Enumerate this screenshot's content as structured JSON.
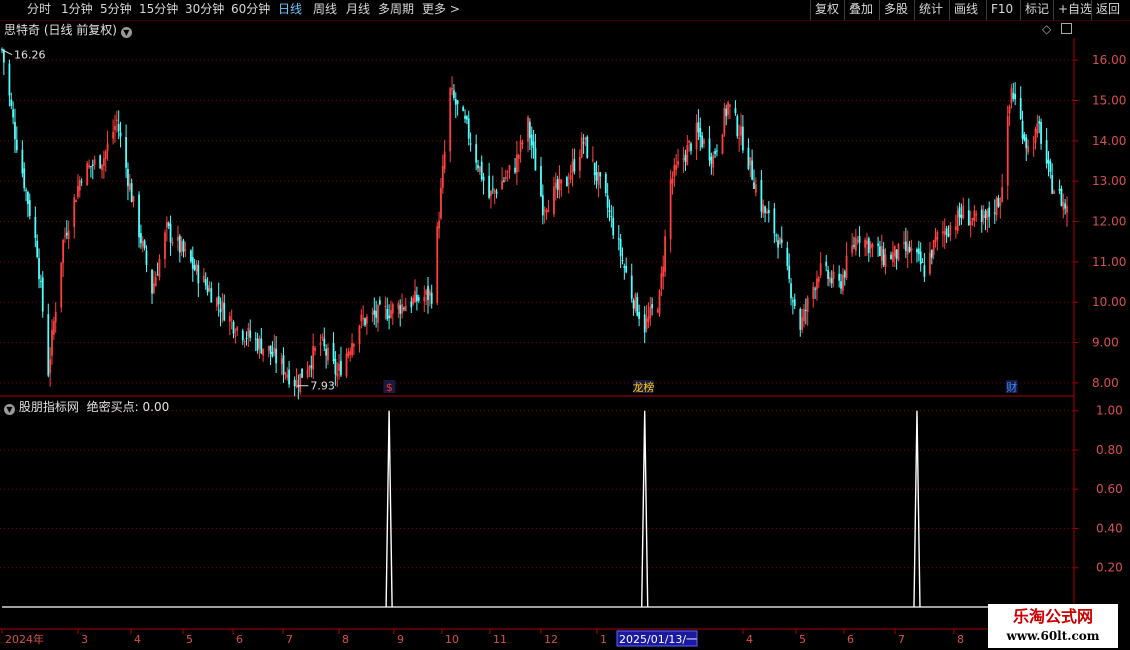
{
  "toolbar": {
    "periods": [
      "分时",
      "1分钟",
      "5分钟",
      "15分钟",
      "30分钟",
      "60分钟",
      "日线",
      "周线",
      "月线",
      "多周期",
      "更多 >"
    ],
    "active_period": "日线",
    "tools": [
      "复权",
      "叠加",
      "多股",
      "统计",
      "画线",
      "F10",
      "标记",
      "+自选",
      "返回"
    ]
  },
  "main_panel": {
    "title": "思特奇 (日线 前复权)",
    "high_marker": "16.26",
    "low_marker": "7.93",
    "event_markers": [
      {
        "label": "$",
        "color": "#ff3030",
        "date": "2024-08-26"
      },
      {
        "label": "龙虎榜",
        "display": "龙榜",
        "color": "#ffcc00",
        "date": "2025-01-08"
      },
      {
        "label": "财",
        "color": "#3a8cff",
        "date": "2025-07-28"
      }
    ]
  },
  "indicator_panel": {
    "title": "股朋指标网",
    "name": "绝密买点:",
    "value": "0.00"
  },
  "time_axis": {
    "labels": [
      "2024年",
      "3",
      "4",
      "5",
      "6",
      "7",
      "8",
      "9",
      "10",
      "11",
      "12",
      "1",
      "2025/01/13/一",
      "4",
      "5",
      "6",
      "7",
      "8"
    ],
    "highlight": "2025/01/13/一"
  },
  "watermark": {
    "line1": "乐淘公式网",
    "line2": "www.60lt.com"
  },
  "colors": {
    "up": "#ff4040",
    "down": "#50ffff",
    "axis": "#b00000",
    "grid": "#7a0000",
    "signal": "#ffffff"
  },
  "chart_data": [
    {
      "type": "candlestick",
      "title": "思特奇 (日线 前复权)",
      "ylim": [
        7.7,
        16.45
      ],
      "y_ticks": [
        8.0,
        9.0,
        10.0,
        11.0,
        12.0,
        13.0,
        14.0,
        15.0,
        16.0
      ],
      "grid": true,
      "x_range": [
        "2024-02-01",
        "2025-08-29"
      ],
      "anchors": [
        {
          "x": "2024-02-01",
          "y": 16.26
        },
        {
          "x": "2024-02-08",
          "y": 14.2
        },
        {
          "x": "2024-02-20",
          "y": 11.3
        },
        {
          "x": "2024-02-26",
          "y": 8.3
        },
        {
          "x": "2024-03-05",
          "y": 11.5
        },
        {
          "x": "2024-03-15",
          "y": 13.2
        },
        {
          "x": "2024-03-27",
          "y": 13.6
        },
        {
          "x": "2024-04-03",
          "y": 14.5
        },
        {
          "x": "2024-04-12",
          "y": 12.4
        },
        {
          "x": "2024-04-22",
          "y": 10.3
        },
        {
          "x": "2024-04-30",
          "y": 11.8
        },
        {
          "x": "2024-05-20",
          "y": 10.5
        },
        {
          "x": "2024-06-06",
          "y": 9.4
        },
        {
          "x": "2024-06-24",
          "y": 8.8
        },
        {
          "x": "2024-07-09",
          "y": 8.0
        },
        {
          "x": "2024-07-22",
          "y": 9.0
        },
        {
          "x": "2024-07-31",
          "y": 8.2
        },
        {
          "x": "2024-08-12",
          "y": 9.5
        },
        {
          "x": "2024-08-28",
          "y": 9.8
        },
        {
          "x": "2024-09-20",
          "y": 10.2
        },
        {
          "x": "2024-09-30",
          "y": 15.2
        },
        {
          "x": "2024-10-09",
          "y": 14.3
        },
        {
          "x": "2024-10-21",
          "y": 12.6
        },
        {
          "x": "2024-11-04",
          "y": 13.4
        },
        {
          "x": "2024-11-11",
          "y": 14.4
        },
        {
          "x": "2024-11-19",
          "y": 12.4
        },
        {
          "x": "2024-12-02",
          "y": 13.0
        },
        {
          "x": "2024-12-11",
          "y": 14.0
        },
        {
          "x": "2024-12-23",
          "y": 12.5
        },
        {
          "x": "2025-01-06",
          "y": 10.2
        },
        {
          "x": "2025-01-13",
          "y": 9.4
        },
        {
          "x": "2025-01-21",
          "y": 10.1
        },
        {
          "x": "2025-01-27",
          "y": 13.0
        },
        {
          "x": "2025-02-10",
          "y": 14.2
        },
        {
          "x": "2025-02-19",
          "y": 13.6
        },
        {
          "x": "2025-02-27",
          "y": 14.9
        },
        {
          "x": "2025-03-07",
          "y": 14.0
        },
        {
          "x": "2025-03-17",
          "y": 12.4
        },
        {
          "x": "2025-03-26",
          "y": 11.6
        },
        {
          "x": "2025-04-07",
          "y": 9.4
        },
        {
          "x": "2025-04-17",
          "y": 10.8
        },
        {
          "x": "2025-04-28",
          "y": 10.4
        },
        {
          "x": "2025-05-08",
          "y": 11.7
        },
        {
          "x": "2025-05-22",
          "y": 11.1
        },
        {
          "x": "2025-06-05",
          "y": 11.3
        },
        {
          "x": "2025-06-13",
          "y": 10.8
        },
        {
          "x": "2025-06-20",
          "y": 11.6
        },
        {
          "x": "2025-07-04",
          "y": 12.2
        },
        {
          "x": "2025-07-14",
          "y": 11.9
        },
        {
          "x": "2025-07-24",
          "y": 12.6
        },
        {
          "x": "2025-07-30",
          "y": 15.3
        },
        {
          "x": "2025-08-08",
          "y": 13.8
        },
        {
          "x": "2025-08-14",
          "y": 14.3
        },
        {
          "x": "2025-08-20",
          "y": 13.0
        },
        {
          "x": "2025-08-29",
          "y": 12.3
        }
      ],
      "annotations": [
        {
          "text": "16.26",
          "x": "2024-02-01",
          "y": 16.26
        },
        {
          "text": "7.93",
          "x": "2024-07-10",
          "y": 7.93
        }
      ]
    },
    {
      "type": "line",
      "title": "股朋指标网 绝密买点",
      "ylim": [
        0,
        1.07
      ],
      "y_ticks": [
        0.2,
        0.4,
        0.6,
        0.8,
        1.0
      ],
      "grid": true,
      "series": [
        {
          "name": "绝密买点",
          "baseline": 0,
          "spikes": [
            {
              "x": "2024-08-28",
              "y": 1.0
            },
            {
              "x": "2025-01-13",
              "y": 1.0
            },
            {
              "x": "2025-06-09",
              "y": 1.0
            }
          ]
        }
      ]
    }
  ]
}
